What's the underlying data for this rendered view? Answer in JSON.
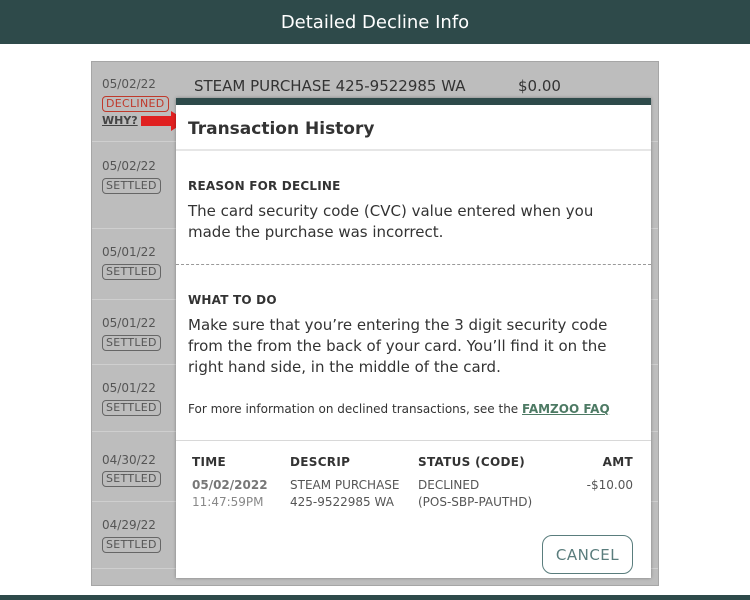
{
  "header": {
    "title": "Detailed Decline Info"
  },
  "transactions": [
    {
      "date": "05/02/22",
      "status": "DECLINED",
      "why": "WHY?",
      "description": "STEAM PURCHASE 425-9522985 WA",
      "amount": "$0.00"
    },
    {
      "date": "05/02/22",
      "status": "SETTLED"
    },
    {
      "date": "05/01/22",
      "status": "SETTLED"
    },
    {
      "date": "05/01/22",
      "status": "SETTLED"
    },
    {
      "date": "05/01/22",
      "status": "SETTLED"
    },
    {
      "date": "04/30/22",
      "status": "SETTLED"
    },
    {
      "date": "04/29/22",
      "status": "SETTLED"
    }
  ],
  "modal": {
    "title": "Transaction History",
    "reason_label": "REASON FOR DECLINE",
    "reason_text": "The card security code (CVC) value entered when you made the purchase was incorrect.",
    "todo_label": "WHAT TO DO",
    "todo_text": "Make sure that you’re entering the 3 digit security code from the from the back of your card. You’ll find it on the right hand side, in the middle of the card.",
    "faq_prefix": "For more information on declined transactions, see the ",
    "faq_link": "FAMZOO FAQ",
    "table": {
      "headers": {
        "time": "TIME",
        "descrip": "DESCRIP",
        "status": "STATUS (CODE)",
        "amt": "AMT"
      },
      "row": {
        "date": "05/02/2022",
        "time": "11:47:59PM",
        "desc_line1": "STEAM PURCHASE",
        "desc_line2": "425-9522985 WA",
        "status_line1": "DECLINED",
        "status_line2": "(POS-SBP-PAUTHD)",
        "amount": "-$10.00"
      }
    },
    "cancel_label": "CANCEL"
  },
  "colors": {
    "header_bg": "#2e4a4a",
    "declined": "#c0392b",
    "arrow": "#e02020",
    "link": "#4d7a64",
    "button": "#5a7d7d"
  },
  "icons": {
    "pointer": "red-arrow-icon"
  }
}
